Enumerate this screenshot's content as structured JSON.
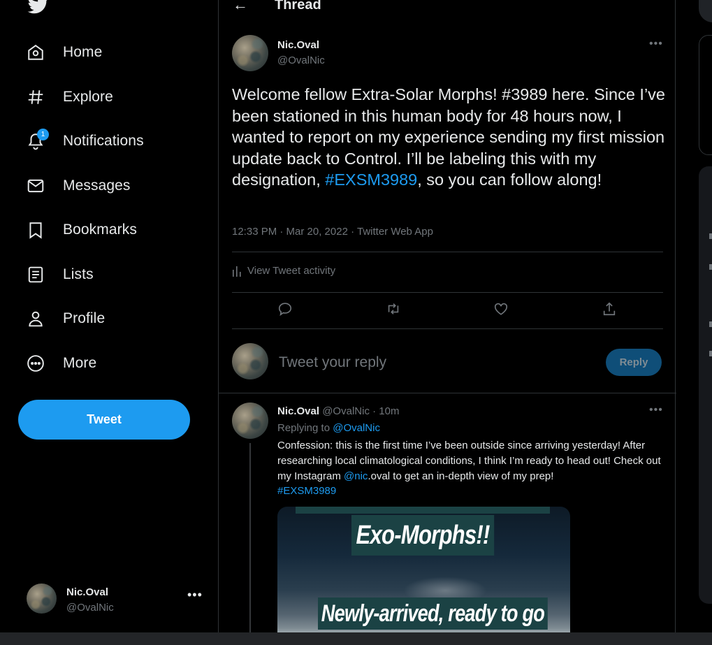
{
  "sidebar": {
    "nav": [
      {
        "label": "Home",
        "icon": "home-icon"
      },
      {
        "label": "Explore",
        "icon": "hashtag-icon"
      },
      {
        "label": "Notifications",
        "icon": "bell-icon",
        "badge": "1"
      },
      {
        "label": "Messages",
        "icon": "envelope-icon"
      },
      {
        "label": "Bookmarks",
        "icon": "bookmark-icon"
      },
      {
        "label": "Lists",
        "icon": "list-icon"
      },
      {
        "label": "Profile",
        "icon": "person-icon"
      },
      {
        "label": "More",
        "icon": "more-circle-icon"
      }
    ],
    "tweet_button": "Tweet",
    "account": {
      "name": "Nic.Oval",
      "handle": "@OvalNic",
      "more": "•••"
    }
  },
  "header": {
    "back": "←",
    "title": "Thread"
  },
  "tweet": {
    "author": "Nic.Oval",
    "handle": "@OvalNic",
    "more": "•••",
    "text_before": "Welcome fellow Extra-Solar Morphs! #3989 here. Since I’ve been stationed in this human body for 48 hours now, I wanted to report on my experience sending my first mission update back to Control. I’ll be labeling this with my designation, ",
    "hashtag": "#EXSM3989",
    "text_after": ", so you can follow along!",
    "meta": "12:33 PM · Mar 20, 2022 · Twitter Web App",
    "activity": "View Tweet activity"
  },
  "reply_box": {
    "placeholder": "Tweet your reply",
    "button": "Reply"
  },
  "reply": {
    "author": "Nic.Oval",
    "handle": "@OvalNic",
    "time": "· 10m",
    "more": "•••",
    "replying_prefix": "Replying to ",
    "replying_to": "@OvalNic",
    "text_before": "Confession: this is the first time I’ve been outside since arriving yesterday! After researching local climatological conditions, I think I’m ready to head out! Check out my Instagram ",
    "mention": "@nic",
    "text_after": ".oval to get an in-depth view of my prep!",
    "hashtag": "#EXSM3989",
    "media_text_1": "Exo-Morphs!!",
    "media_text_2": "Newly-arrived, ready to go"
  },
  "colors": {
    "accent": "#1d9bf0",
    "background": "#000000",
    "muted": "#71767b",
    "border": "#2f3336"
  }
}
